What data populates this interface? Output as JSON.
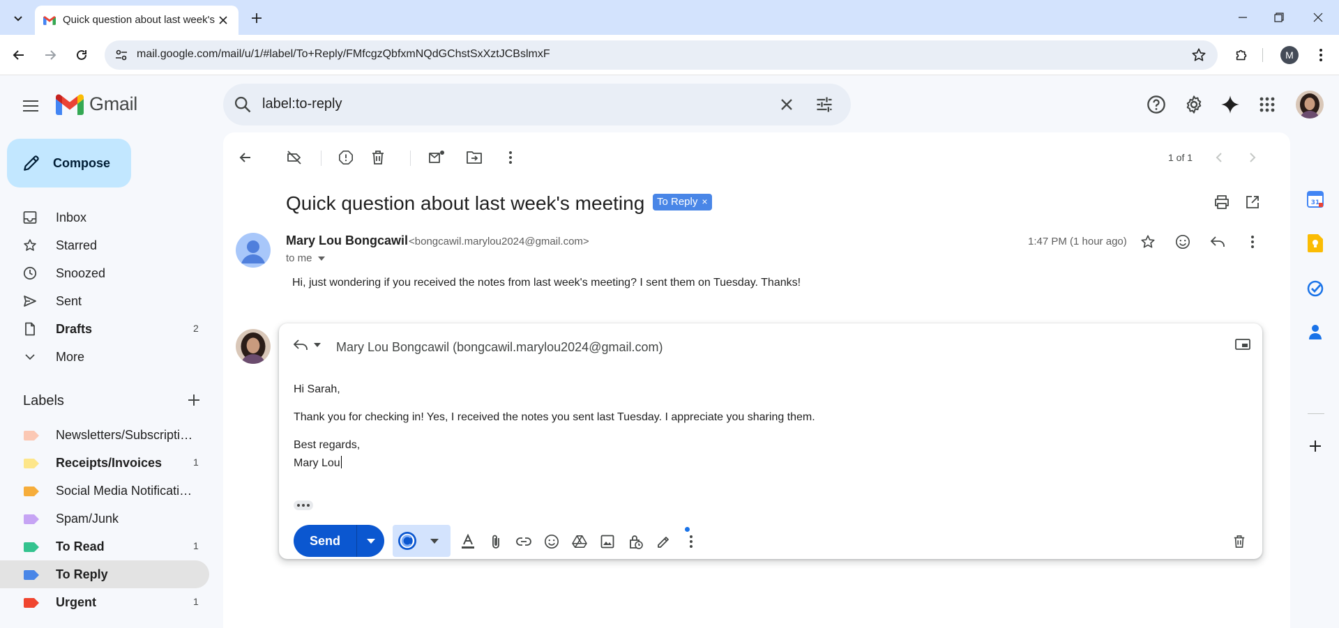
{
  "browser": {
    "tab_title": "Quick question about last week's meeting",
    "url": "mail.google.com/mail/u/1/#label/To+Reply/FMfcgzQbfxmNQdGChstSxXztJCBslmxF",
    "profile_initial": "M"
  },
  "gmail": {
    "logo_text": "Gmail",
    "search_query": "label:to-reply",
    "compose_label": "Compose",
    "nav": [
      {
        "label": "Inbox",
        "count": ""
      },
      {
        "label": "Starred",
        "count": ""
      },
      {
        "label": "Snoozed",
        "count": ""
      },
      {
        "label": "Sent",
        "count": ""
      },
      {
        "label": "Drafts",
        "count": "2"
      },
      {
        "label": "More",
        "count": ""
      }
    ],
    "labels_header": "Labels",
    "labels": [
      {
        "label": "Newsletters/Subscriptions",
        "count": "",
        "color": "#fbc8b4"
      },
      {
        "label": "Receipts/Invoices",
        "count": "1",
        "color": "#fde68a"
      },
      {
        "label": "Social Media Notifications",
        "count": "",
        "color": "#f6ad3b"
      },
      {
        "label": "Spam/Junk",
        "count": "",
        "color": "#c6a4f4"
      },
      {
        "label": "To Read",
        "count": "1",
        "color": "#34c38f"
      },
      {
        "label": "To Reply",
        "count": "",
        "color": "#4986e7"
      },
      {
        "label": "Urgent",
        "count": "1",
        "color": "#f0452f"
      }
    ],
    "pager": "1 of 1"
  },
  "email": {
    "subject": "Quick question about last week's meeting",
    "label_chip": "To Reply",
    "chip_close": "×",
    "sender_name": "Mary Lou Bongcawil",
    "sender_email": "<bongcawil.marylou2024@gmail.com>",
    "to": "to me",
    "time": "1:47 PM (1 hour ago)",
    "body": "Hi, just wondering if you received the notes from last week's meeting? I sent them on Tuesday. Thanks!"
  },
  "reply": {
    "to": "Mary Lou Bongcawil (bongcawil.marylou2024@gmail.com)",
    "greeting": "Hi Sarah,",
    "body": "Thank you for checking in! Yes, I received the notes you sent last Tuesday. I appreciate you sharing them.",
    "signoff": "Best regards,",
    "signature": "Mary Lou",
    "send_label": "Send"
  },
  "colors": {
    "accent": "#0b57d0",
    "compose_bg": "#c2e7ff",
    "chip_bg": "#4986e7",
    "active_label_bg": "#e3e3e3"
  }
}
